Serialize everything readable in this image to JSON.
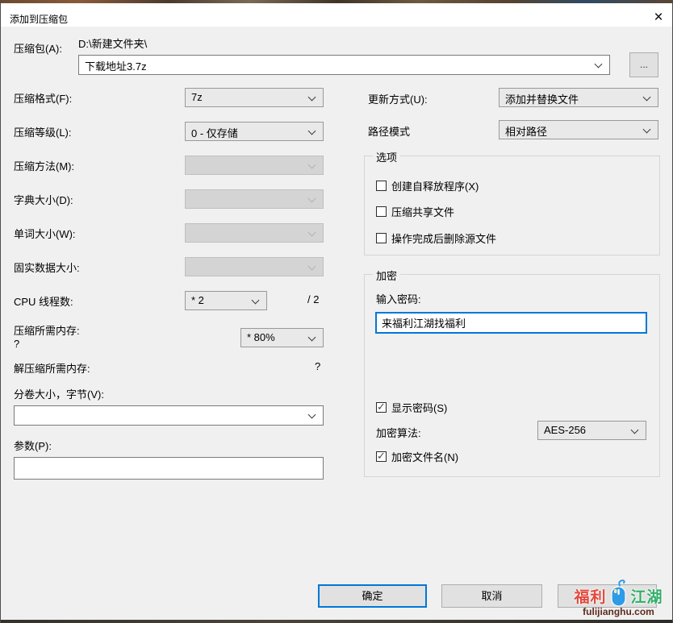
{
  "window": {
    "title": "添加到压缩包",
    "close_glyph": "×"
  },
  "archive": {
    "label": "压缩包(A):",
    "dir": "D:\\新建文件夹\\",
    "filename": "下载地址3.7z",
    "browse": "..."
  },
  "format": {
    "label": "压缩格式(F):",
    "value": "7z"
  },
  "level": {
    "label": "压缩等级(L):",
    "value": "0 - 仅存储"
  },
  "method": {
    "label": "压缩方法(M):",
    "value": ""
  },
  "dict": {
    "label": "字典大小(D):",
    "value": ""
  },
  "word": {
    "label": "单词大小(W):",
    "value": ""
  },
  "solid": {
    "label": "固实数据大小:",
    "value": ""
  },
  "cpu": {
    "label": "CPU 线程数:",
    "value": "* 2",
    "total": "/ 2"
  },
  "memCompress": {
    "label": "压缩所需内存:",
    "amount": "?",
    "percent": "* 80%"
  },
  "memDecompress": {
    "label": "解压缩所需内存:",
    "amount": "?"
  },
  "volume": {
    "label": "分卷大小，字节(V):",
    "value": ""
  },
  "params": {
    "label": "参数(P):",
    "value": ""
  },
  "update": {
    "label": "更新方式(U):",
    "value": "添加并替换文件"
  },
  "pathMode": {
    "label": "路径模式",
    "value": "相对路径"
  },
  "options": {
    "title": "选项",
    "items": [
      {
        "label": "创建自释放程序(X)",
        "checked": false
      },
      {
        "label": "压缩共享文件",
        "checked": false
      },
      {
        "label": "操作完成后删除源文件",
        "checked": false
      }
    ]
  },
  "encryption": {
    "title": "加密",
    "passwordLabel": "输入密码:",
    "password": "来福利江湖找福利",
    "showPassword": {
      "label": "显示密码(S)",
      "checked": true
    },
    "methodLabel": "加密算法:",
    "method": "AES-256",
    "encryptNames": {
      "label": "加密文件名(N)",
      "checked": true
    }
  },
  "buttons": {
    "ok": "确定",
    "cancel": "取消"
  },
  "watermark": {
    "part1": "福利",
    "part2": "江湖",
    "url": "fulijianghu.com",
    "red": "#e2483d",
    "green": "#2fae68",
    "blue": "#2e9be6",
    "dark": "#5d2b1e"
  }
}
